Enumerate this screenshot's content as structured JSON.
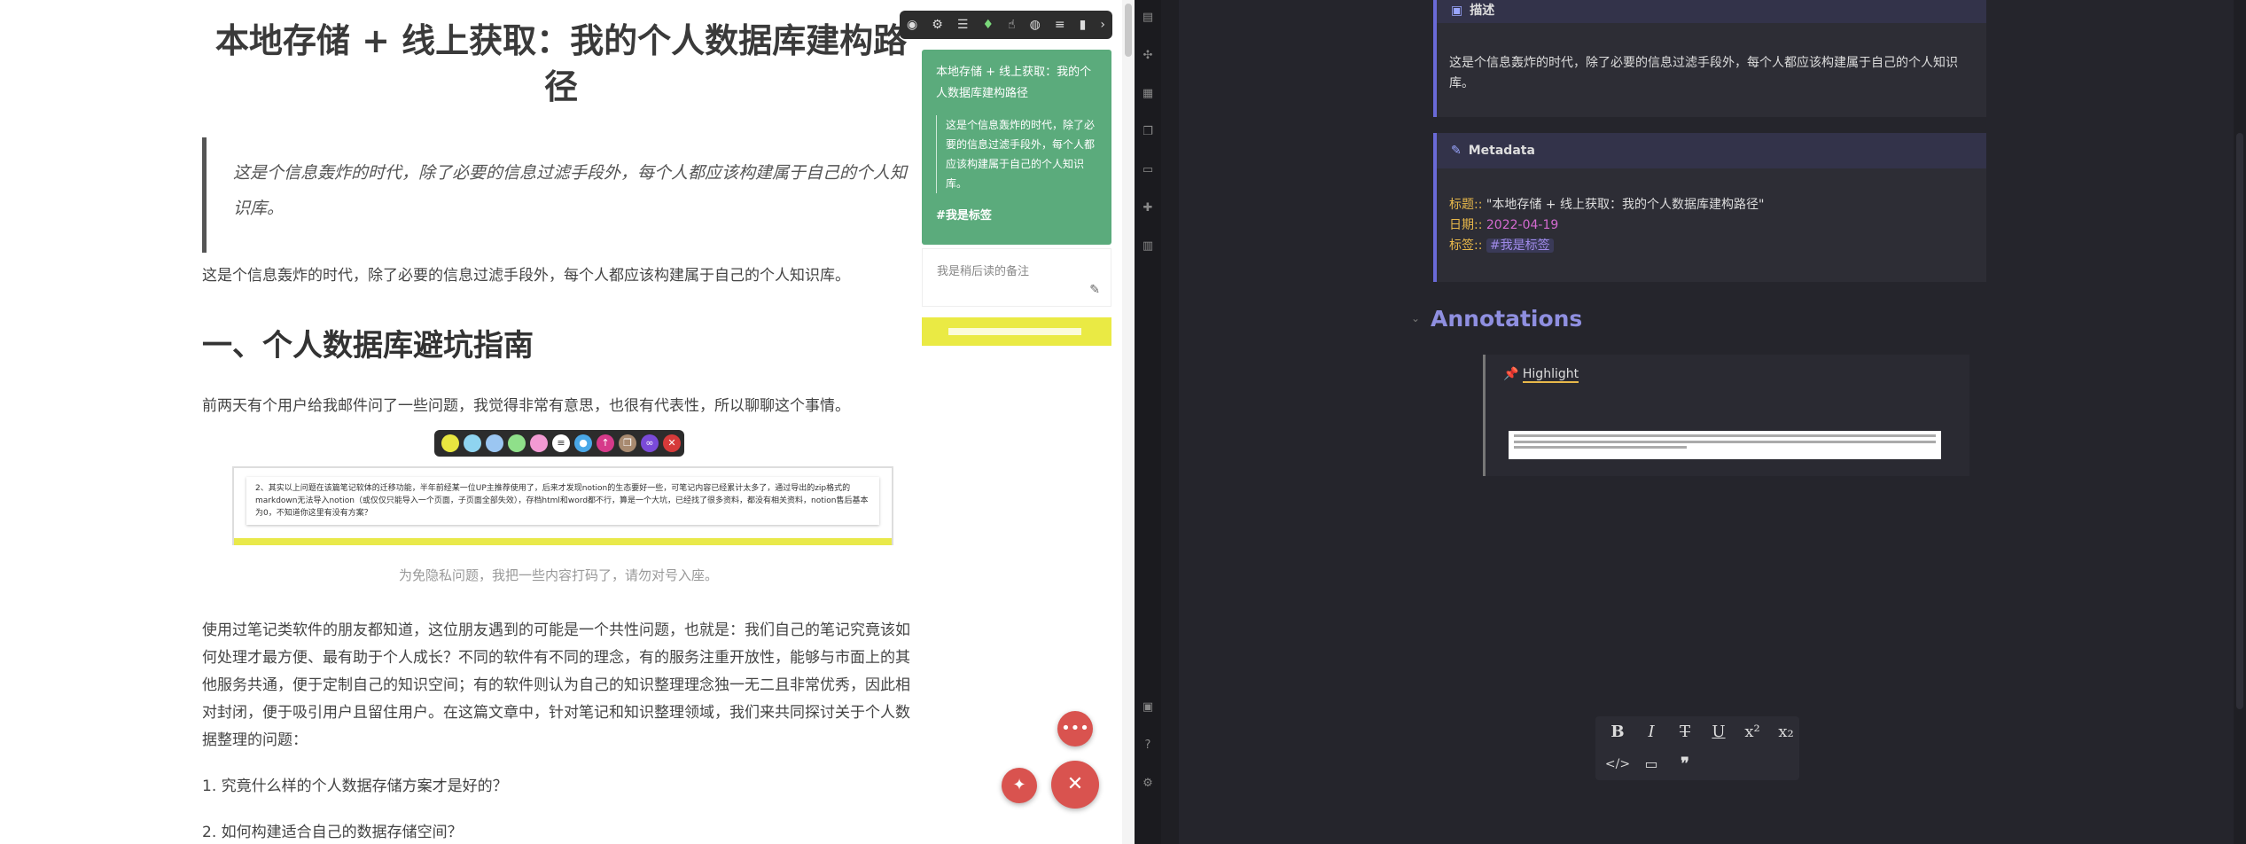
{
  "left": {
    "title": "本地存储 + 线上获取：我的个人数据库建构路径",
    "quote": "这是个信息轰炸的时代，除了必要的信息过滤手段外，每个人都应该构建属于自己的个人知识库。",
    "intro": "这是个信息轰炸的时代，除了必要的信息过滤手段外，每个人都应该构建属于自己的个人知识库。",
    "h1": "一、个人数据库避坑指南",
    "p1": "前两天有个用户给我邮件问了一些问题，我觉得非常有意思，也很有代表性，所以聊聊这个事情。",
    "image_text": "2、其实以上问题在该篇笔记软体的迁移功能，半年前经某一位UP主推荐使用了，后来才发现notion的生态要好一些，可笔记内容已经累计太多了，通过导出的zip格式的markdown无法导入notion（或仅仅只能导入一个页面，子页面全部失效），存档html和word都不行，算是一个大坑，已经找了很多资料，都没有相关资料，notion售后基本为0，不知道你这里有没有方案？",
    "caption": "为免隐私问题，我把一些内容打码了，请勿对号入座。",
    "p2": "使用过笔记类软件的朋友都知道，这位朋友遇到的可能是一个共性问题，也就是：我们自己的笔记究竟该如何处理才最方便、最有助于个人成长？不同的软件有不同的理念，有的服务注重开放性，能够与市面上的其他服务共通，便于定制自己的知识空间；有的软件则认为自己的知识整理理念独一无二且非常优秀，因此相对封闭，便于吸引用户且留住用户。在这篇文章中，针对笔记和知识整理领域，我们来共同探讨关于个人数据整理的问题：",
    "list1": "1. 究竟什么样的个人数据存储方案才是好的？",
    "list2": "2. 如何构建适合自己的数据存储空间？",
    "sidebar_card": {
      "title": "本地存储 + 线上获取：我的个人数据库建构路径",
      "quote": "这是个信息轰炸的时代，除了必要的信息过滤手段外，每个人都应该构建属于自己的个人知识库。",
      "tag": "#我是标签"
    },
    "note_text": "我是稍后读的备注",
    "colors": {
      "card_green": "#5bab7c",
      "highlight_yellow": "#e9e94a",
      "fab_red": "#d9534f"
    }
  },
  "right": {
    "desc_header": "描述",
    "desc_text": "这是个信息轰炸的时代，除了必要的信息过滤手段外，每个人都应该构建属于自己的个人知识库。",
    "meta_header": "Metadata",
    "meta": {
      "title_key": "标题::",
      "title_val": "\"本地存储 + 线上获取：我的个人数据库建构路径\"",
      "date_key": "日期::",
      "date_val": "2022-04-19",
      "tag_key": "标签::",
      "tag_val": "#我是标签"
    },
    "annotations_title": "Annotations",
    "highlight_label": "Highlight",
    "colors": {
      "accent": "#6a6ad8",
      "key": "#e8b84a",
      "date": "#d46ad0",
      "annotations": "#8f8fe0"
    }
  }
}
